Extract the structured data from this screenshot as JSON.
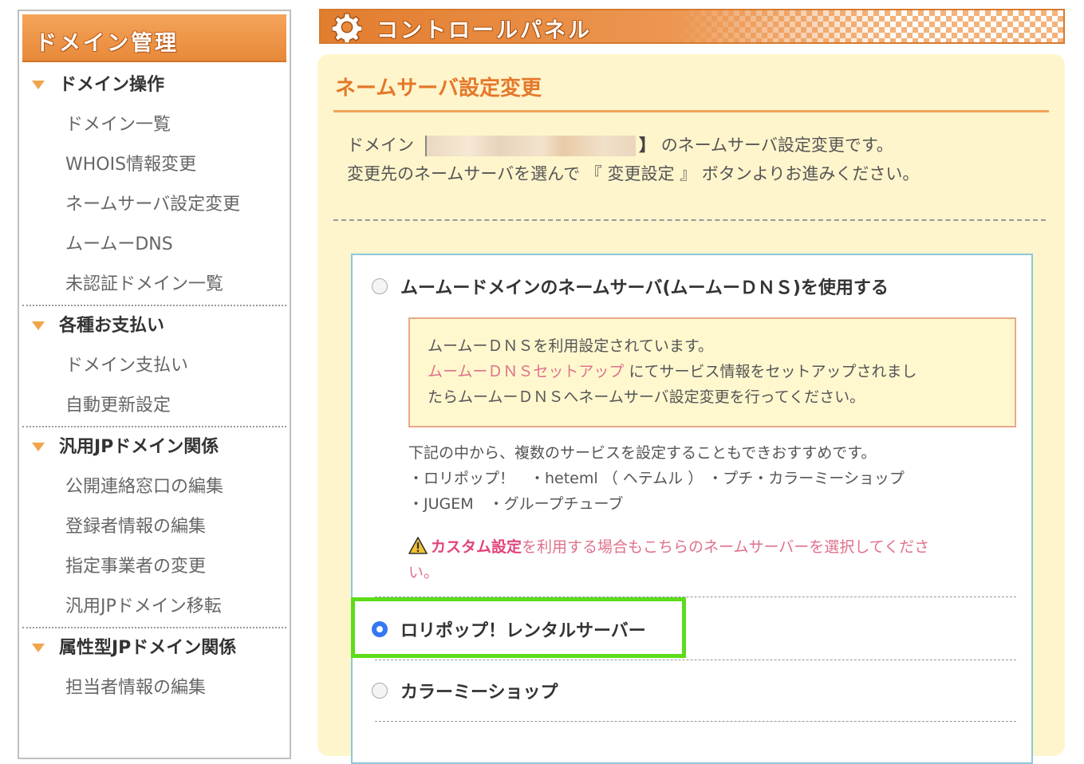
{
  "sidebar": {
    "header": "ドメイン管理",
    "sections": [
      {
        "title": "ドメイン操作",
        "items": [
          "ドメイン一覧",
          "WHOIS情報変更",
          "ネームサーバ設定変更",
          "ムームーDNS",
          "未認証ドメイン一覧"
        ]
      },
      {
        "title": "各種お支払い",
        "items": [
          "ドメイン支払い",
          "自動更新設定"
        ]
      },
      {
        "title": "汎用JPドメイン関係",
        "items": [
          "公開連絡窓口の編集",
          "登録者情報の編集",
          "指定事業者の変更",
          "汎用JPドメイン移転"
        ]
      },
      {
        "title": "属性型JPドメイン関係",
        "items": [
          "担当者情報の編集"
        ]
      }
    ]
  },
  "banner": {
    "title": "コントロールパネル",
    "icon": "gear-icon"
  },
  "main": {
    "title": "ネームサーバ設定変更",
    "intro": {
      "prefix": "ドメイン",
      "bracket_close": "】",
      "suffix": "のネームサーバ設定変更です。",
      "line2": "変更先のネームサーバを選んで 『 変更設定 』 ボタンよりお進みください。"
    },
    "options": [
      {
        "label": "ムームードメインのネームサーバ(ムームーＤＮＳ)を使用する",
        "checked": false
      },
      {
        "label": "ロリポップ！レンタルサーバー",
        "checked": true
      },
      {
        "label": "カラーミーショップ",
        "checked": false
      }
    ],
    "notice": {
      "line1": "ムームーＤＮＳを利用設定されています。",
      "link": "ムームーＤＮＳセットアップ",
      "line2_rest": " にてサービス情報をセットアップされまし",
      "line3": "たらムームーＤＮＳへネームサーバ設定変更を行ってください。"
    },
    "services": {
      "intro": "下記の中から、複数のサービスを設定することもできおすすめです。",
      "line1": "・ロリポップ！　・heteml （ ヘテムル ） ・プチ・カラーミーショップ",
      "line2": "・JUGEM　・グループチューブ"
    },
    "warning": {
      "strong": "カスタム設定",
      "text": "を利用する場合もこちらのネームサーバーを選択してくださ",
      "text2": "い。"
    }
  },
  "colors": {
    "accent_orange": "#e5782a",
    "panel_bg": "#fff5cc",
    "link_pink": "#e0718a",
    "highlight_green": "#5cdc1a",
    "radio_selected": "#3478f6"
  }
}
